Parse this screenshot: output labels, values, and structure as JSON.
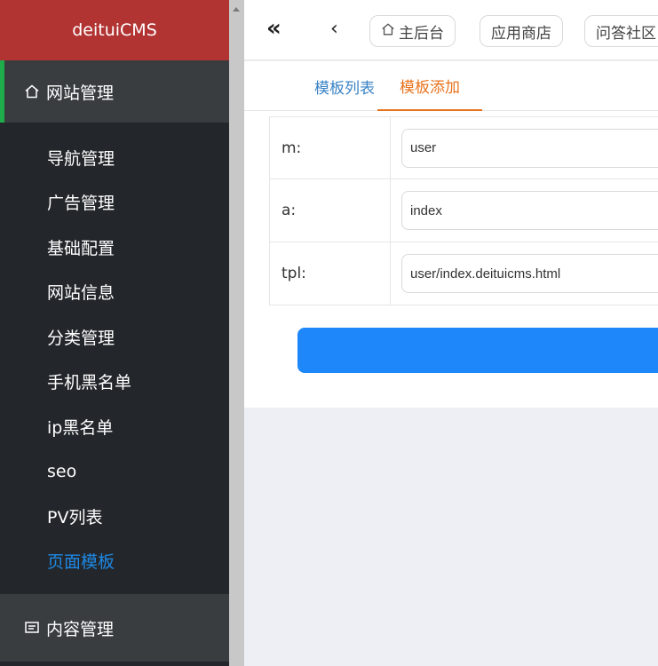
{
  "sidebar": {
    "brand": "deituiCMS",
    "group1": {
      "label": "网站管理",
      "icon": "home-icon"
    },
    "items": [
      {
        "label": "导航管理"
      },
      {
        "label": "广告管理"
      },
      {
        "label": "基础配置"
      },
      {
        "label": "网站信息"
      },
      {
        "label": "分类管理"
      },
      {
        "label": "手机黑名单"
      },
      {
        "label": "ip黑名单"
      },
      {
        "label": "seo"
      },
      {
        "label": "PV列表"
      },
      {
        "label": "页面模板"
      }
    ],
    "group2": {
      "label": "内容管理",
      "icon": "content-icon"
    }
  },
  "topbar": {
    "double_left": "«",
    "single_left": "‹",
    "tabs": [
      {
        "label": "主后台",
        "icon": "home-icon"
      },
      {
        "label": "应用商店"
      },
      {
        "label": "问答社区"
      }
    ]
  },
  "subtabs": {
    "list": "模板列表",
    "add": "模板添加"
  },
  "form": {
    "rows": [
      {
        "label": "m:",
        "value": "user"
      },
      {
        "label": "a:",
        "value": "index"
      },
      {
        "label": "tpl:",
        "value": "user/index.deituicms.html"
      }
    ]
  },
  "colors": {
    "brand_bg": "#b13433",
    "accent_active": "#e8731f",
    "link": "#3a83c5",
    "submit": "#1e88fb",
    "sidebar_current": "#1e88e5"
  }
}
